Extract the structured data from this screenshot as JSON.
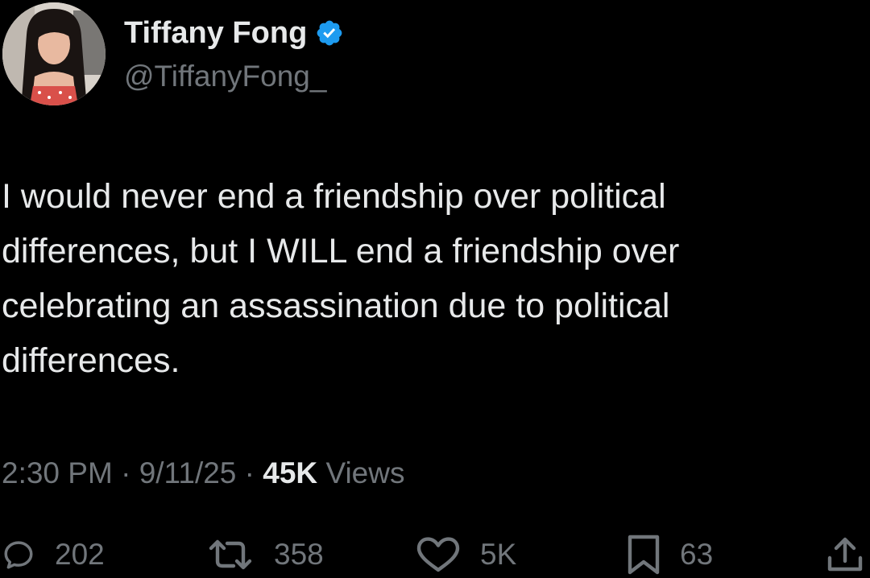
{
  "user": {
    "display_name": "Tiffany Fong",
    "handle": "@TiffanyFong_"
  },
  "tweet": {
    "lines": [
      "I would never end a friendship over political",
      "differences, but I WILL end a friendship over",
      "celebrating an assassination due to political",
      "differences."
    ],
    "time": "2:30 PM",
    "date": "9/11/25",
    "views_count": "45K",
    "views_label": "Views",
    "separator": "·"
  },
  "actions": {
    "replies": "202",
    "reposts": "358",
    "likes": "5K",
    "bookmarks": "63"
  },
  "icons": {
    "verified": "verified-badge-icon",
    "reply": "reply-bubble-icon",
    "repost": "repost-arrows-icon",
    "like": "heart-icon",
    "bookmark": "bookmark-icon",
    "share": "share-upload-icon"
  },
  "colors": {
    "background": "#000000",
    "primary_text": "#e7e9ea",
    "secondary_text": "#71767b",
    "verified_blue": "#1d9bf0"
  }
}
